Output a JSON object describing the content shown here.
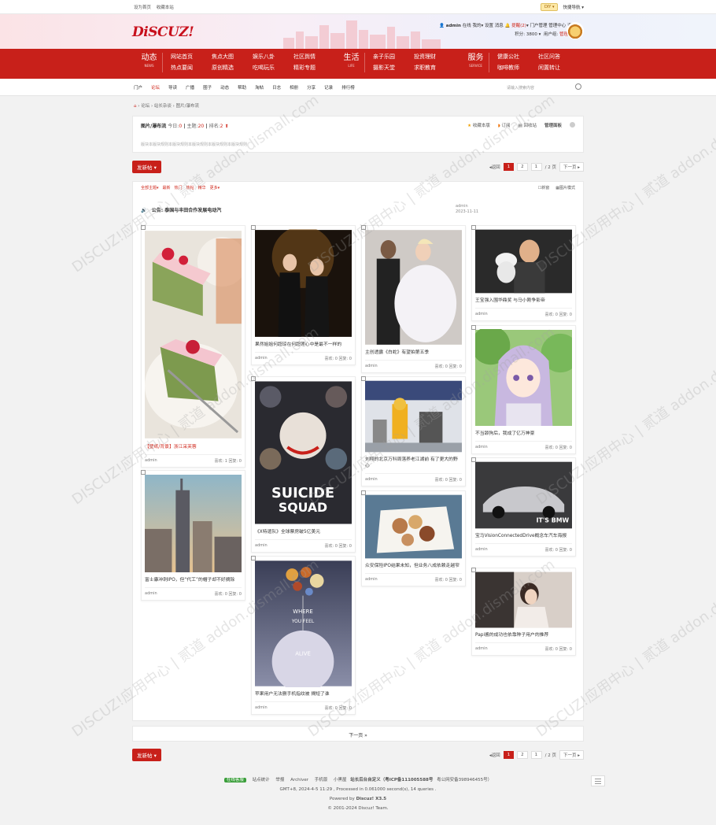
{
  "topbar": {
    "set_home": "设为首页",
    "favorite": "收藏本站",
    "diy": "DIY",
    "quick_nav": "快捷导航"
  },
  "header": {
    "logo": "DiSCUZ!",
    "user": "admin",
    "online": "在线",
    "my": "我的",
    "settings": "设置",
    "messages": "消息",
    "remind": "提醒(2)",
    "portal_admin": "门户管理",
    "admin_center": "管理中心",
    "logout": "退出",
    "points": "积分: 3800",
    "group_label": "用户组:",
    "group": "管理员"
  },
  "nav": {
    "groups": [
      {
        "head": "动态",
        "sub": "NEWS",
        "items": [
          "网站首页",
          "焦点大图",
          "娱乐八卦",
          "热点要闻",
          "原创精选",
          "吃喝玩乐"
        ],
        "extra": [
          "社区舆情",
          "精彩专题"
        ]
      },
      {
        "head": "生活",
        "sub": "LIFE",
        "items": [
          "亲子乐园",
          "投资理财",
          "摄影天堂",
          "求职教育"
        ]
      },
      {
        "head": "服务",
        "sub": "SERVICE",
        "items": [
          "健康公社",
          "社区问答",
          "咖啡教师",
          "闲置转让"
        ]
      }
    ]
  },
  "subnav": {
    "items": [
      "门户",
      "论坛",
      "导读",
      "广播",
      "圈子",
      "动态",
      "帮助",
      "淘帖",
      "日志",
      "相册",
      "分享",
      "记录",
      "排行榜"
    ],
    "search_placeholder": "请输入搜索内容"
  },
  "crumbs": [
    "论坛",
    "站长杂谈",
    "图片/瀑布流"
  ],
  "forum": {
    "name": "图片/瀑布流",
    "today_label": "今日:",
    "today": "0",
    "topics_label": "主题:",
    "topics": "20",
    "rank_label": "排名:",
    "rank": "2",
    "fav": "收藏本版",
    "subscribe": "订阅",
    "recycle": "回收站",
    "manage": "管理面板",
    "rules": "版块本版块规则本版块规则本版块规则本版块规则本版块规则"
  },
  "actions": {
    "new_post": "发新帖"
  },
  "pager": {
    "back": "返回",
    "pages": [
      "1",
      "2"
    ],
    "input": "1",
    "total": "/ 2 页",
    "next": "下一页"
  },
  "filters": {
    "items": [
      "全部主题",
      "最新",
      "热门",
      "热帖",
      "精华",
      "更多"
    ],
    "new_window": "新窗",
    "image_mode": "图片模式"
  },
  "notice": {
    "label": "公告:",
    "text": "泰国与丰田合作发展电动汽",
    "author": "admin",
    "date": "2023-11-11"
  },
  "cards": [
    {
      "title": "【壁纸/背景】浙江采芙蓉",
      "red": true,
      "author": "admin",
      "likes": "喜欢: 1",
      "replies": "回复: 0"
    },
    {
      "title": "富士康冲刺IPO，但“代工”的帽子却不好摘除",
      "author": "admin",
      "likes": "喜欢: 0",
      "replies": "回复: 0"
    },
    {
      "title": "果然姐姐何超琼在何超莲心中是最不一样的",
      "author": "admin",
      "likes": "喜欢: 0",
      "replies": "回复: 0"
    },
    {
      "title": "《X特遣队》全球票房破5亿美元",
      "author": "admin",
      "likes": "喜欢: 0",
      "replies": "回复: 0"
    },
    {
      "title": "苹果用户无法删手机指纹被 揭短了谁",
      "author": "admin",
      "likes": "喜欢: 0",
      "replies": "回复: 0"
    },
    {
      "title": "主创透露《白蛇》有望拍第五季",
      "author": "admin",
      "likes": "喜欢: 0",
      "replies": "回复: 0"
    },
    {
      "title": "刘翔的北京万科周落养老江湖前 有了更大的野心",
      "author": "admin",
      "likes": "喜欢: 0",
      "replies": "回复: 0"
    },
    {
      "title": "众安保险IPO结果未知，但业务八成依赖走越窄",
      "author": "admin",
      "likes": "喜欢: 0",
      "replies": "回复: 0"
    },
    {
      "title": "王宝强入围华鼎奖 与马小刚争影帝",
      "author": "admin",
      "likes": "喜欢: 0",
      "replies": "回复: 0"
    },
    {
      "title": "不当舔狗后，我成了亿万神豪",
      "author": "admin",
      "likes": "喜欢: 0",
      "replies": "回复: 0"
    },
    {
      "title": "宝马VisionConnectedDrive概念车汽车海报",
      "author": "admin",
      "likes": "喜欢: 0",
      "replies": "回复: 0"
    },
    {
      "title": "Papi酱的成功也依靠种子用户的推荐",
      "author": "admin",
      "likes": "喜欢: 0",
      "replies": "回复: 0"
    }
  ],
  "more": "下一页 »",
  "footer": {
    "badge": "在线客服",
    "links": [
      "站点统计",
      "举报",
      "Archiver",
      "手机版",
      "小黑屋",
      "站长后台自定义（粤ICP备111005588号",
      "粤公网安备398946455号）"
    ],
    "stats": "GMT+8, 2024-4-5 11:29 , Processed in 0.061000 second(s), 14 queries .",
    "powered_label": "Powered by",
    "powered": "Discuz! X3.5",
    "copyright": "© 2001-2024 Discuz! Team."
  },
  "poster": {
    "where": "WHERE",
    "you": "YOU FEEL",
    "alive": "ALIVE",
    "bmw": "IT'S BMW"
  },
  "watermark": "DISCUZ!应用中心 | 贰道  addon.dismall.com"
}
